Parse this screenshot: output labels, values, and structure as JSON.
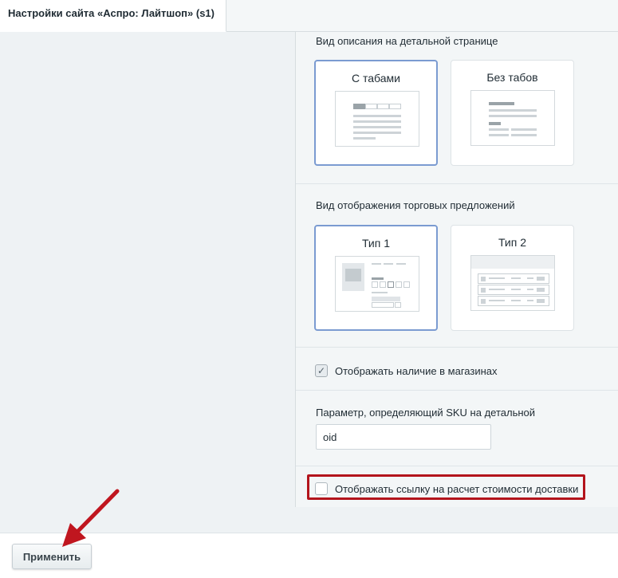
{
  "window": {
    "title": "Настройки сайта «Аспро: Лайтшоп» (s1)"
  },
  "detail_view": {
    "label": "Вид описания на детальной странице",
    "options": [
      {
        "label": "С табами",
        "selected": true
      },
      {
        "label": "Без табов",
        "selected": false
      }
    ]
  },
  "offers_view": {
    "label": "Вид отображения торговых предложений",
    "options": [
      {
        "label": "Тип 1",
        "selected": true
      },
      {
        "label": "Тип 2",
        "selected": false
      }
    ]
  },
  "stores_checkbox": {
    "label": "Отображать наличие в магазинах",
    "checked": true
  },
  "sku_param": {
    "label": "Параметр, определяющий SKU на детальной",
    "value": "oid"
  },
  "delivery_checkbox": {
    "label": "Отображать ссылку на расчет стоимости доставки",
    "checked": false
  },
  "footer": {
    "apply_label": "Применить"
  },
  "colors": {
    "selected_border": "#7b9bd1",
    "highlight": "#b3141c",
    "arrow": "#c0161f"
  }
}
